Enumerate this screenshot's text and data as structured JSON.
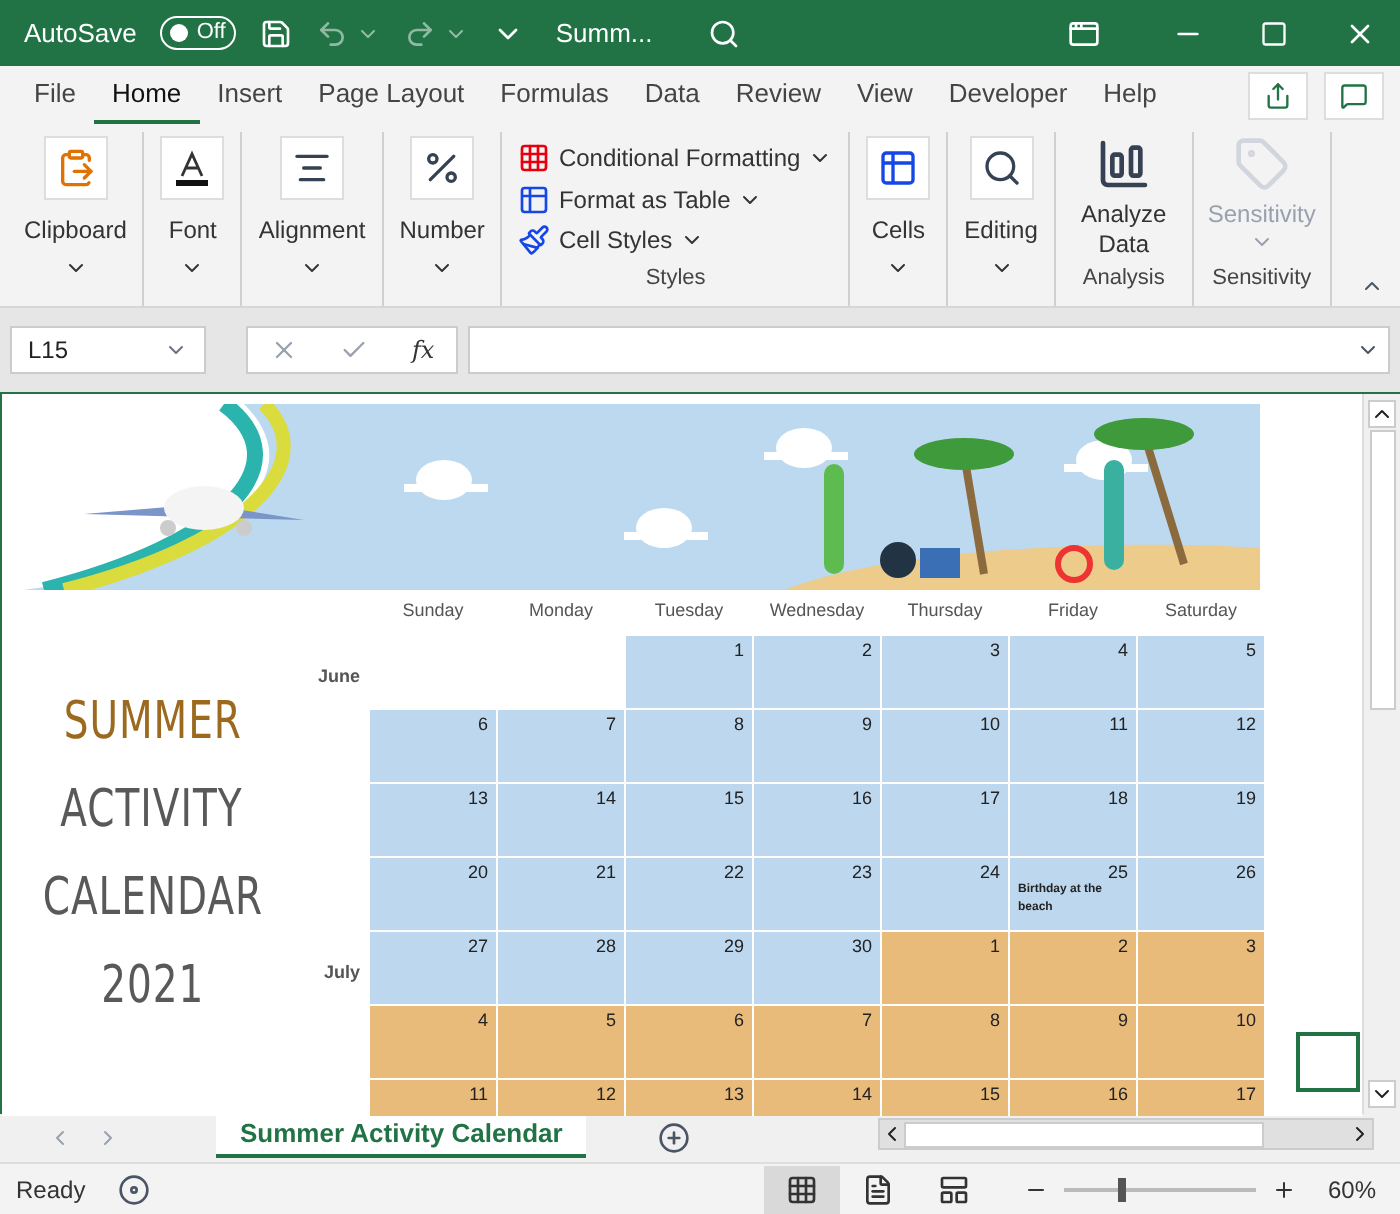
{
  "title_bar": {
    "autosave_label": "AutoSave",
    "autosave": {
      "label": "Off",
      "on": false
    },
    "file_name": "Summ..."
  },
  "ribbon_tabs": [
    {
      "label": "File",
      "selected": false
    },
    {
      "label": "Home",
      "selected": true
    },
    {
      "label": "Insert",
      "selected": false
    },
    {
      "label": "Page Layout",
      "selected": false
    },
    {
      "label": "Formulas",
      "selected": false
    },
    {
      "label": "Data",
      "selected": false
    },
    {
      "label": "Review",
      "selected": false
    },
    {
      "label": "View",
      "selected": false
    },
    {
      "label": "Developer",
      "selected": false
    },
    {
      "label": "Help",
      "selected": false
    }
  ],
  "ribbon_groups": [
    {
      "kind": "big",
      "label": "Clipboard"
    },
    {
      "kind": "big",
      "label": "Font"
    },
    {
      "kind": "big",
      "label": "Alignment"
    },
    {
      "kind": "big",
      "label": "Number"
    },
    {
      "kind": "list",
      "group_label": "Styles",
      "items": [
        {
          "label": "Conditional Formatting"
        },
        {
          "label": "Format as Table"
        },
        {
          "label": "Cell Styles"
        }
      ]
    },
    {
      "kind": "big",
      "label": "Cells"
    },
    {
      "kind": "big",
      "label": "Editing"
    },
    {
      "kind": "analyze",
      "label": "Analyze Data",
      "group_label": "Analysis",
      "disabled": false
    },
    {
      "kind": "analyze",
      "label": "Sensitivity",
      "group_label": "Sensitivity",
      "disabled": true
    }
  ],
  "formula_bar": {
    "name_box": "L15",
    "fx": "fx"
  },
  "calendar": {
    "title_lines": [
      {
        "text": "SUMMER",
        "color": "#9c6a1e"
      },
      {
        "text": "ACTIVITY",
        "color": "#595959"
      },
      {
        "text": "CALENDAR",
        "color": "#595959"
      },
      {
        "text": "2021",
        "color": "#595959"
      }
    ],
    "weekdays": [
      "Sunday",
      "Monday",
      "Tuesday",
      "Wednesday",
      "Thursday",
      "Friday",
      "Saturday"
    ],
    "weeks": [
      {
        "month": "June",
        "days": [
          {
            "kind": "empty"
          },
          {
            "kind": "empty"
          },
          {
            "kind": "june",
            "day": "1"
          },
          {
            "kind": "june",
            "day": "2"
          },
          {
            "kind": "june",
            "day": "3"
          },
          {
            "kind": "june",
            "day": "4"
          },
          {
            "kind": "june",
            "day": "5"
          }
        ]
      },
      {
        "days": [
          {
            "kind": "june",
            "day": "6"
          },
          {
            "kind": "june",
            "day": "7"
          },
          {
            "kind": "june",
            "day": "8"
          },
          {
            "kind": "june",
            "day": "9"
          },
          {
            "kind": "june",
            "day": "10"
          },
          {
            "kind": "june",
            "day": "11"
          },
          {
            "kind": "june",
            "day": "12"
          }
        ]
      },
      {
        "days": [
          {
            "kind": "june",
            "day": "13"
          },
          {
            "kind": "june",
            "day": "14"
          },
          {
            "kind": "june",
            "day": "15"
          },
          {
            "kind": "june",
            "day": "16"
          },
          {
            "kind": "june",
            "day": "17"
          },
          {
            "kind": "june",
            "day": "18"
          },
          {
            "kind": "june",
            "day": "19"
          }
        ]
      },
      {
        "days": [
          {
            "kind": "june",
            "day": "20"
          },
          {
            "kind": "june",
            "day": "21"
          },
          {
            "kind": "june",
            "day": "22"
          },
          {
            "kind": "june",
            "day": "23"
          },
          {
            "kind": "june",
            "day": "24"
          },
          {
            "kind": "june",
            "day": "25",
            "note": "Birthday at the beach"
          },
          {
            "kind": "june",
            "day": "26"
          }
        ]
      },
      {
        "month": "July",
        "days": [
          {
            "kind": "june",
            "day": "27"
          },
          {
            "kind": "june",
            "day": "28"
          },
          {
            "kind": "june",
            "day": "29"
          },
          {
            "kind": "june",
            "day": "30"
          },
          {
            "kind": "july",
            "day": "1"
          },
          {
            "kind": "july",
            "day": "2"
          },
          {
            "kind": "july",
            "day": "3"
          }
        ]
      },
      {
        "days": [
          {
            "kind": "july",
            "day": "4"
          },
          {
            "kind": "july",
            "day": "5"
          },
          {
            "kind": "july",
            "day": "6"
          },
          {
            "kind": "july",
            "day": "7"
          },
          {
            "kind": "july",
            "day": "8"
          },
          {
            "kind": "july",
            "day": "9"
          },
          {
            "kind": "july",
            "day": "10"
          }
        ]
      },
      {
        "days": [
          {
            "kind": "july",
            "day": "11"
          },
          {
            "kind": "july",
            "day": "12"
          },
          {
            "kind": "july",
            "day": "13"
          },
          {
            "kind": "july",
            "day": "14"
          },
          {
            "kind": "july",
            "day": "15"
          },
          {
            "kind": "july",
            "day": "16"
          },
          {
            "kind": "july",
            "day": "17"
          }
        ]
      }
    ]
  },
  "sheet_tabs": [
    {
      "label": "Summer Activity Calendar",
      "selected": true
    }
  ],
  "status_bar": {
    "status": "Ready",
    "views": [
      {
        "kind": "normal",
        "selected": true
      },
      {
        "kind": "page_layout",
        "selected": false
      },
      {
        "kind": "page_break",
        "selected": false
      }
    ],
    "zoom": {
      "level": 0.3,
      "reading": "60%"
    }
  }
}
